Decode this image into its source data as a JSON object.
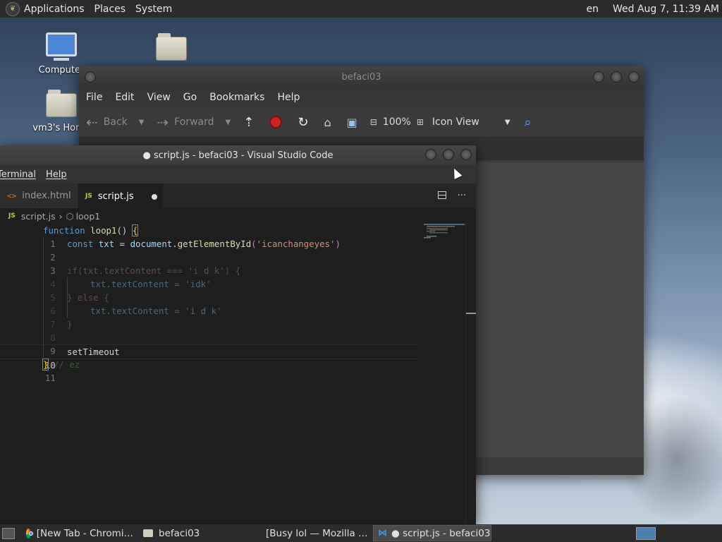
{
  "top_panel": {
    "menus": [
      "Applications",
      "Places",
      "System"
    ],
    "language": "en",
    "clock": "Wed Aug  7, 11:39 AM"
  },
  "desktop_icons": [
    "Computer",
    "vm3's Home"
  ],
  "file_manager": {
    "title": "befaci03",
    "menu": [
      "File",
      "Edit",
      "View",
      "Go",
      "Bookmarks",
      "Help"
    ],
    "toolbar": {
      "back": "Back",
      "forward": "Forward",
      "zoom": "100%",
      "view_mode": "Icon View"
    }
  },
  "vscode": {
    "title": "● script.js - befaci03 - Visual Studio Code",
    "menu": [
      "Terminal",
      "Help"
    ],
    "tabs": [
      {
        "label": "index.html",
        "icon": "html-icon"
      },
      {
        "label": "script.js",
        "icon": "js-icon",
        "modified": true
      }
    ],
    "breadcrumb": {
      "file": "script.js",
      "symbol": "loop1"
    },
    "code": {
      "l1": {
        "n": "1",
        "kw": "function",
        "fn": "loop1",
        "rest": "() ",
        "br": "{"
      },
      "l2": {
        "n": "2",
        "kw": "const",
        "v": "txt",
        "eq": " = ",
        "obj": "document",
        "m": "getElementById",
        "s": "'icanchangeyes'"
      },
      "l3": {
        "n": "3"
      },
      "l4": {
        "n": "4",
        "text": "if(txt.textContent === 'i d k') {"
      },
      "l5": {
        "n": "5",
        "text": "txt.textContent = 'idk'"
      },
      "l6": {
        "n": "6",
        "text": "} else {"
      },
      "l7": {
        "n": "7",
        "text": "txt.textContent = 'i d k'"
      },
      "l8": {
        "n": "8",
        "text": "}"
      },
      "l9": {
        "n": "9"
      },
      "l10": {
        "n": "10",
        "text": "setTimeout"
      },
      "l11": {
        "n": "11",
        "br": "}",
        "cm": "// ez"
      }
    }
  },
  "taskbar": [
    {
      "label": "[New Tab - Chromi…",
      "icon": "chrome-icon"
    },
    {
      "label": "befaci03",
      "icon": "folder-icon"
    },
    {
      "label": "[Busy lol — Mozilla …",
      "icon": "firefox-icon"
    },
    {
      "label": "● script.js - befaci03…",
      "icon": "vscode-icon",
      "active": true
    }
  ],
  "colors": {
    "panel": "#2b2b2b",
    "editor_bg": "#1e1e1e",
    "keyword": "#569cd6",
    "string": "#ce9178"
  }
}
